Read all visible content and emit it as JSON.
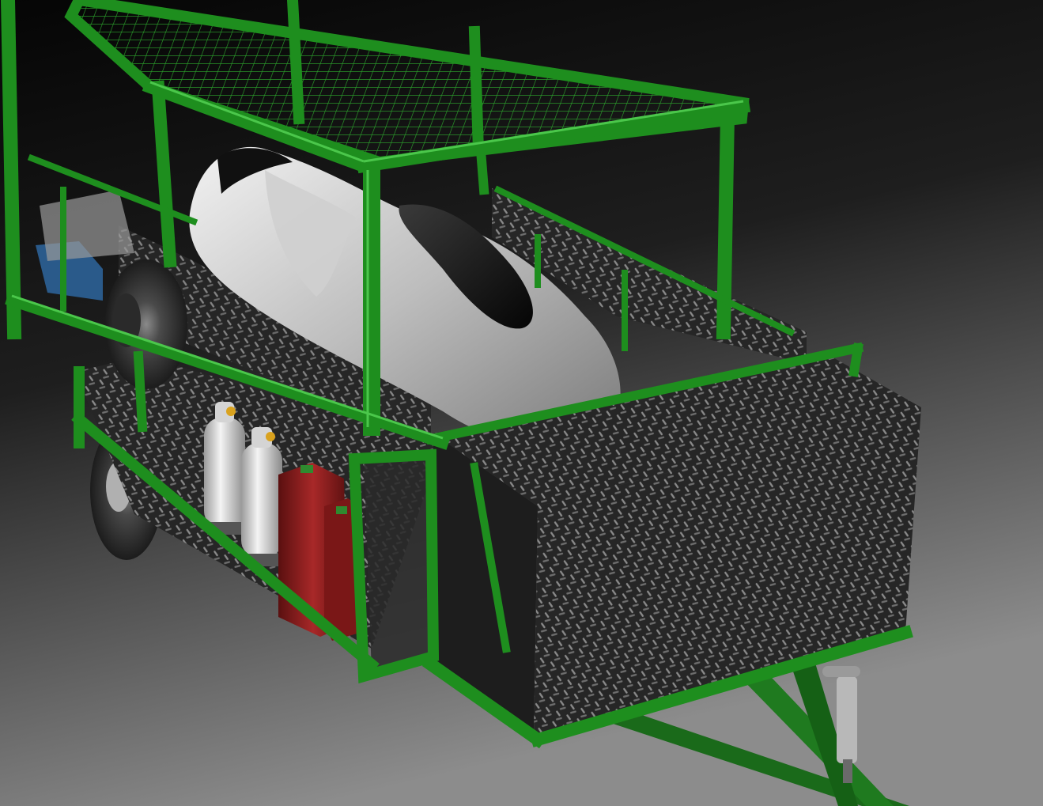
{
  "scene": {
    "subject": "trailer-render",
    "colors": {
      "background_top": "#050505",
      "background_bottom": "#8c8c8c",
      "frame_green": "#1f8a1f",
      "frame_green_dark": "#0d4a0d",
      "frame_green_light": "#4fd24f",
      "plate_dark": "#2a2a2a",
      "plate_mid": "#4a4a4a",
      "car_body": "#d9d9d9",
      "car_glass": "#151515",
      "tire": "#3a3a3a",
      "gas_bottle": "#e6e6e6",
      "jerry_can": "#8e1d1d"
    }
  }
}
